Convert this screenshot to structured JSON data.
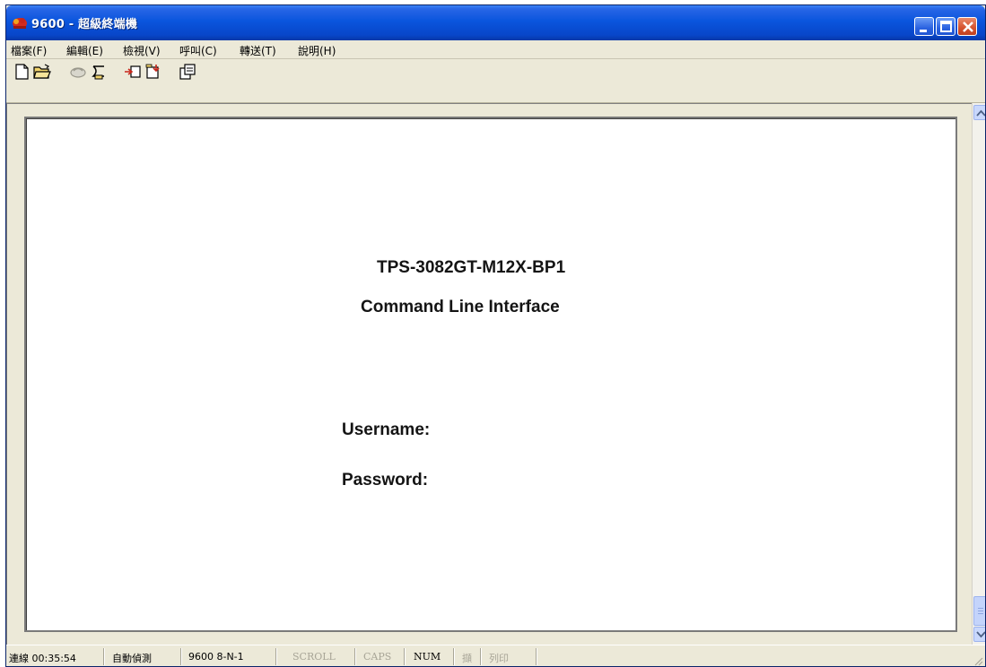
{
  "window": {
    "title": "9600 - 超級終端機",
    "app_icon": "hyperterminal-icon",
    "controls": {
      "minimize": "minimize-icon",
      "maximize": "maximize-icon",
      "close": "close-icon"
    }
  },
  "menu": {
    "items": [
      "檔案(F)",
      "編輯(E)",
      "檢視(V)",
      "呼叫(C)",
      "轉送(T)",
      "說明(H)"
    ]
  },
  "toolbar": {
    "icons": [
      "new-document-icon",
      "open-folder-icon",
      "connect-icon",
      "disconnect-icon",
      "send-file-icon",
      "receive-file-icon",
      "properties-icon"
    ]
  },
  "terminal": {
    "model": "TPS-3082GT-M12X-BP1",
    "subtitle": "Command Line Interface",
    "username_prompt": "Username:",
    "password_prompt": "Password:"
  },
  "statusbar": {
    "connection": "連線 00:35:54",
    "detect": "自動偵測",
    "settings": "9600 8-N-1",
    "scroll": "SCROLL",
    "caps": "CAPS",
    "num": "NUM",
    "capture": "擷",
    "print": "列印"
  },
  "colors": {
    "titlebar": "#0a55dd",
    "close_button": "#d5522e",
    "chrome": "#ece9d8",
    "terminal_bg": "#ffffff",
    "terminal_text": "#141414"
  }
}
